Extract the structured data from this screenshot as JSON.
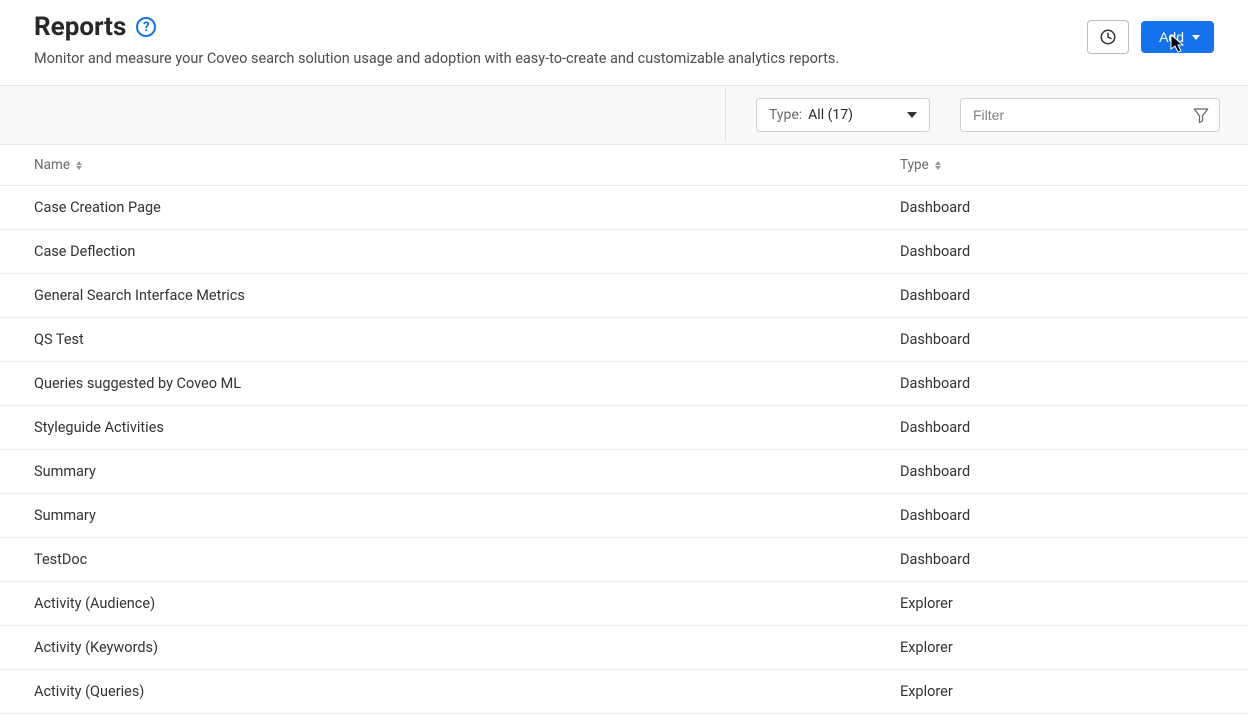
{
  "header": {
    "title": "Reports",
    "subtitle": "Monitor and measure your Coveo search solution usage and adoption with easy-to-create and customizable analytics reports.",
    "add_label": "Add"
  },
  "toolbar": {
    "type_label": "Type:",
    "type_value": "All (17)",
    "filter_placeholder": "Filter"
  },
  "columns": {
    "name": "Name",
    "type": "Type"
  },
  "rows": [
    {
      "name": "Case Creation Page",
      "type": "Dashboard"
    },
    {
      "name": "Case Deflection",
      "type": "Dashboard"
    },
    {
      "name": "General Search Interface Metrics",
      "type": "Dashboard"
    },
    {
      "name": "QS Test",
      "type": "Dashboard"
    },
    {
      "name": "Queries suggested by Coveo ML",
      "type": "Dashboard"
    },
    {
      "name": "Styleguide Activities",
      "type": "Dashboard"
    },
    {
      "name": "Summary",
      "type": "Dashboard"
    },
    {
      "name": "Summary",
      "type": "Dashboard"
    },
    {
      "name": "TestDoc",
      "type": "Dashboard"
    },
    {
      "name": "Activity (Audience)",
      "type": "Explorer"
    },
    {
      "name": "Activity (Keywords)",
      "type": "Explorer"
    },
    {
      "name": "Activity (Queries)",
      "type": "Explorer"
    }
  ]
}
